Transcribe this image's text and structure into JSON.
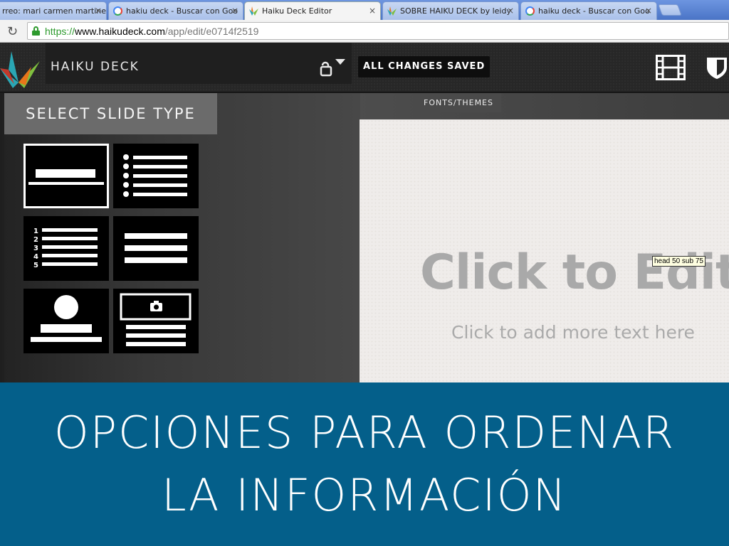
{
  "browser": {
    "tabs": [
      {
        "label": "rreo: mari carmen martinez",
        "icon": "none"
      },
      {
        "label": "hakiu deck - Buscar con Goo",
        "icon": "google-icon"
      },
      {
        "label": "Haiku Deck Editor",
        "icon": "haiku-deck-icon"
      },
      {
        "label": "SOBRE HAIKU DECK by leidy",
        "icon": "haiku-deck-icon"
      },
      {
        "label": "haiku deck - Buscar con Goo",
        "icon": "google-icon"
      }
    ],
    "active_tab": 2,
    "close_glyph": "×",
    "reload_glyph": "↻",
    "url": {
      "scheme": "https://",
      "host": "www.haikudeck.com",
      "path": "/app/edit/e0714f2519"
    }
  },
  "app": {
    "brand": "HAIKU DECK",
    "save_status": "ALL CHANGES SAVED",
    "colors": {
      "logo_teal": "#2aa7b5",
      "logo_green": "#7fbf3f",
      "logo_orange": "#e8751a",
      "logo_red": "#c0392b"
    }
  },
  "panel": {
    "title": "SELECT SLIDE TYPE",
    "list_numbers": [
      "1",
      "2",
      "3",
      "4",
      "5"
    ],
    "layouts": [
      "title",
      "bullet-list",
      "numbered-list",
      "text-lines",
      "profile",
      "photo-with-text"
    ],
    "selected": 0
  },
  "fonts_themes": "FONTS/THEMES",
  "slide": {
    "title": "Click to Edit",
    "subtitle": "Click to add more text here"
  },
  "tooltip": "head 50 sub 75",
  "banner": {
    "line1": "OPCIONES PARA ORDENAR",
    "line2": "LA INFORMACIÓN",
    "color": "#045f8a"
  }
}
